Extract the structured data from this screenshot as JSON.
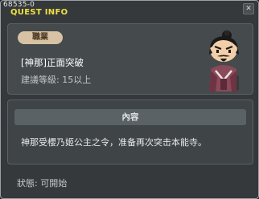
{
  "window": {
    "id_text": "68535-0",
    "title": "QUEST INFO",
    "close_label": "✕"
  },
  "quest": {
    "job_badge": "職業",
    "name": "[神那]正面突破",
    "level_text": "建議等級: 15以上"
  },
  "content": {
    "header": "內容",
    "text": "神那受櫻乃姬公主之令，准备再次突击本能寺。"
  },
  "status": {
    "text": "狀態: 可開始"
  },
  "icons": {
    "npc": "samurai-npc-portrait"
  },
  "colors": {
    "title": "#f0e040",
    "badge_bg": "#d8c2a4",
    "window_bg": "#35393c"
  }
}
